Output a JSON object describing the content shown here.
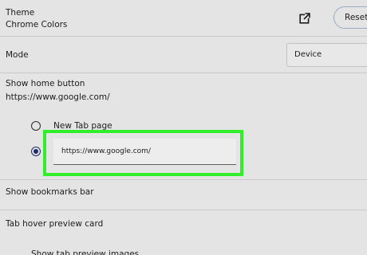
{
  "theme": {
    "title": "Theme",
    "value": "Chrome Colors",
    "reset_label": "Reset"
  },
  "mode": {
    "label": "Mode",
    "selected": "Device"
  },
  "home_button": {
    "title": "Show home button",
    "url_summary": "https://www.google.com/",
    "options": [
      {
        "label": "New Tab page",
        "checked": false
      },
      {
        "label": "",
        "checked": true
      }
    ],
    "custom_url_value": "https://www.google.com/"
  },
  "bookmarks_bar": {
    "label": "Show bookmarks bar"
  },
  "tab_hover": {
    "label": "Tab hover preview card"
  },
  "tab_preview_images": {
    "label": "Show tab preview images"
  },
  "colors": {
    "background": "#e4e4e4",
    "highlight": "#30ef2a",
    "radio_selected": "#1f2d6b"
  }
}
